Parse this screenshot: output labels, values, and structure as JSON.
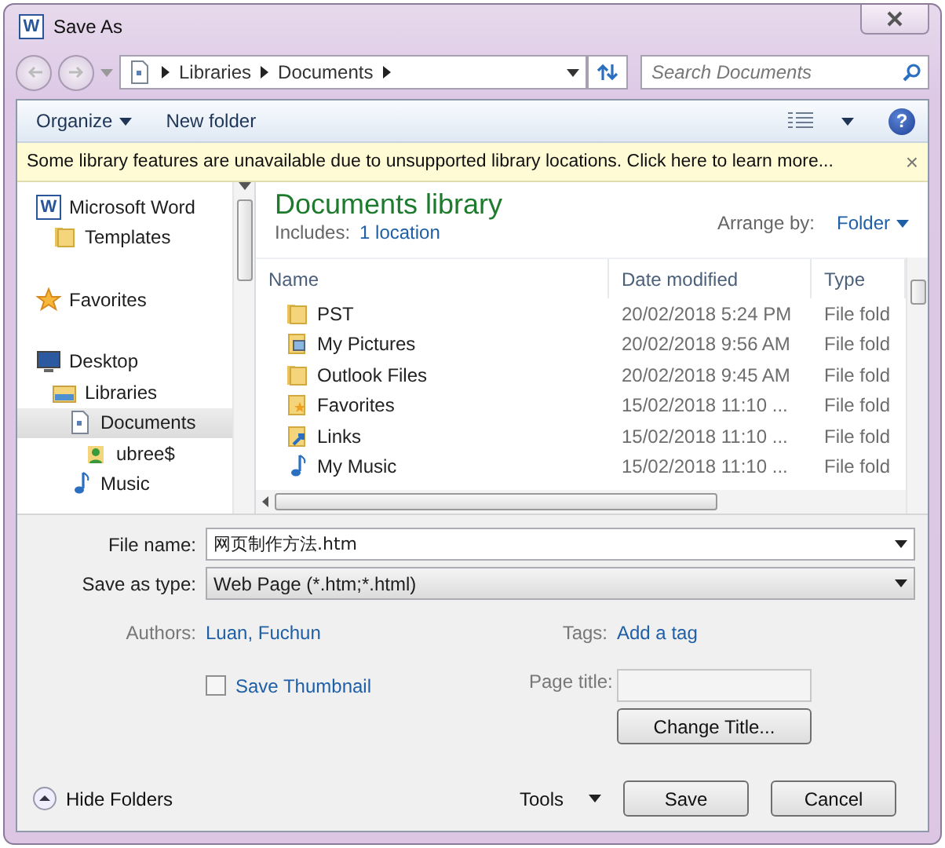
{
  "window": {
    "title": "Save As",
    "icon_letter": "W"
  },
  "address": {
    "crumbs": [
      "Libraries",
      "Documents"
    ]
  },
  "search": {
    "placeholder": "Search Documents"
  },
  "toolbar": {
    "organize": "Organize",
    "new_folder": "New folder",
    "help": "?"
  },
  "infobar": {
    "message": "Some library features are unavailable due to unsupported library locations. Click here to learn more...",
    "close": "×"
  },
  "sidebar": {
    "items": [
      {
        "kind": "word",
        "icon_letter": "W",
        "label": "Microsoft Word",
        "selected": false,
        "children": [
          {
            "kind": "folder",
            "label": "Templates",
            "selected": false
          }
        ]
      },
      {
        "kind": "star",
        "label": "Favorites",
        "selected": false
      },
      {
        "kind": "desktop",
        "label": "Desktop",
        "selected": false,
        "children": [
          {
            "kind": "library",
            "label": "Libraries",
            "selected": false,
            "children": [
              {
                "kind": "document",
                "label": "Documents",
                "selected": true,
                "children": [
                  {
                    "kind": "user",
                    "label": "ubree$",
                    "selected": false
                  }
                ]
              },
              {
                "kind": "music",
                "label": "Music",
                "selected": false
              }
            ]
          }
        ]
      }
    ]
  },
  "library": {
    "title": "Documents library",
    "includes_label": "Includes:",
    "includes_link": "1 location",
    "arrange_label": "Arrange by:",
    "arrange_value": "Folder"
  },
  "table": {
    "columns": [
      "Name",
      "Date modified",
      "Type"
    ],
    "rows": [
      {
        "kind": "folder",
        "name": "PST",
        "date": "20/02/2018 5:24 PM",
        "type": "File fold"
      },
      {
        "kind": "pictures",
        "name": "My Pictures",
        "date": "20/02/2018 9:56 AM",
        "type": "File fold"
      },
      {
        "kind": "folder",
        "name": "Outlook Files",
        "date": "20/02/2018 9:45 AM",
        "type": "File fold"
      },
      {
        "kind": "favorites",
        "name": "Favorites",
        "date": "15/02/2018 11:10 ...",
        "type": "File fold"
      },
      {
        "kind": "links",
        "name": "Links",
        "date": "15/02/2018 11:10 ...",
        "type": "File fold"
      },
      {
        "kind": "music",
        "name": "My Music",
        "date": "15/02/2018 11:10 ...",
        "type": "File fold"
      }
    ]
  },
  "form": {
    "file_name_label": "File name:",
    "file_name": "网页制作方法.htm",
    "type_label": "Save as type:",
    "type_value": "Web Page (*.htm;*.html)",
    "authors_label": "Authors:",
    "authors": "Luan, Fuchun",
    "tags_label": "Tags:",
    "tags": "Add a tag",
    "thumbnail": {
      "label": "Save Thumbnail",
      "checked": false
    },
    "page_title_label": "Page title:",
    "change_title": "Change Title..."
  },
  "footer": {
    "hide_folders": "Hide Folders",
    "tools": "Tools",
    "save": "Save",
    "cancel": "Cancel"
  }
}
